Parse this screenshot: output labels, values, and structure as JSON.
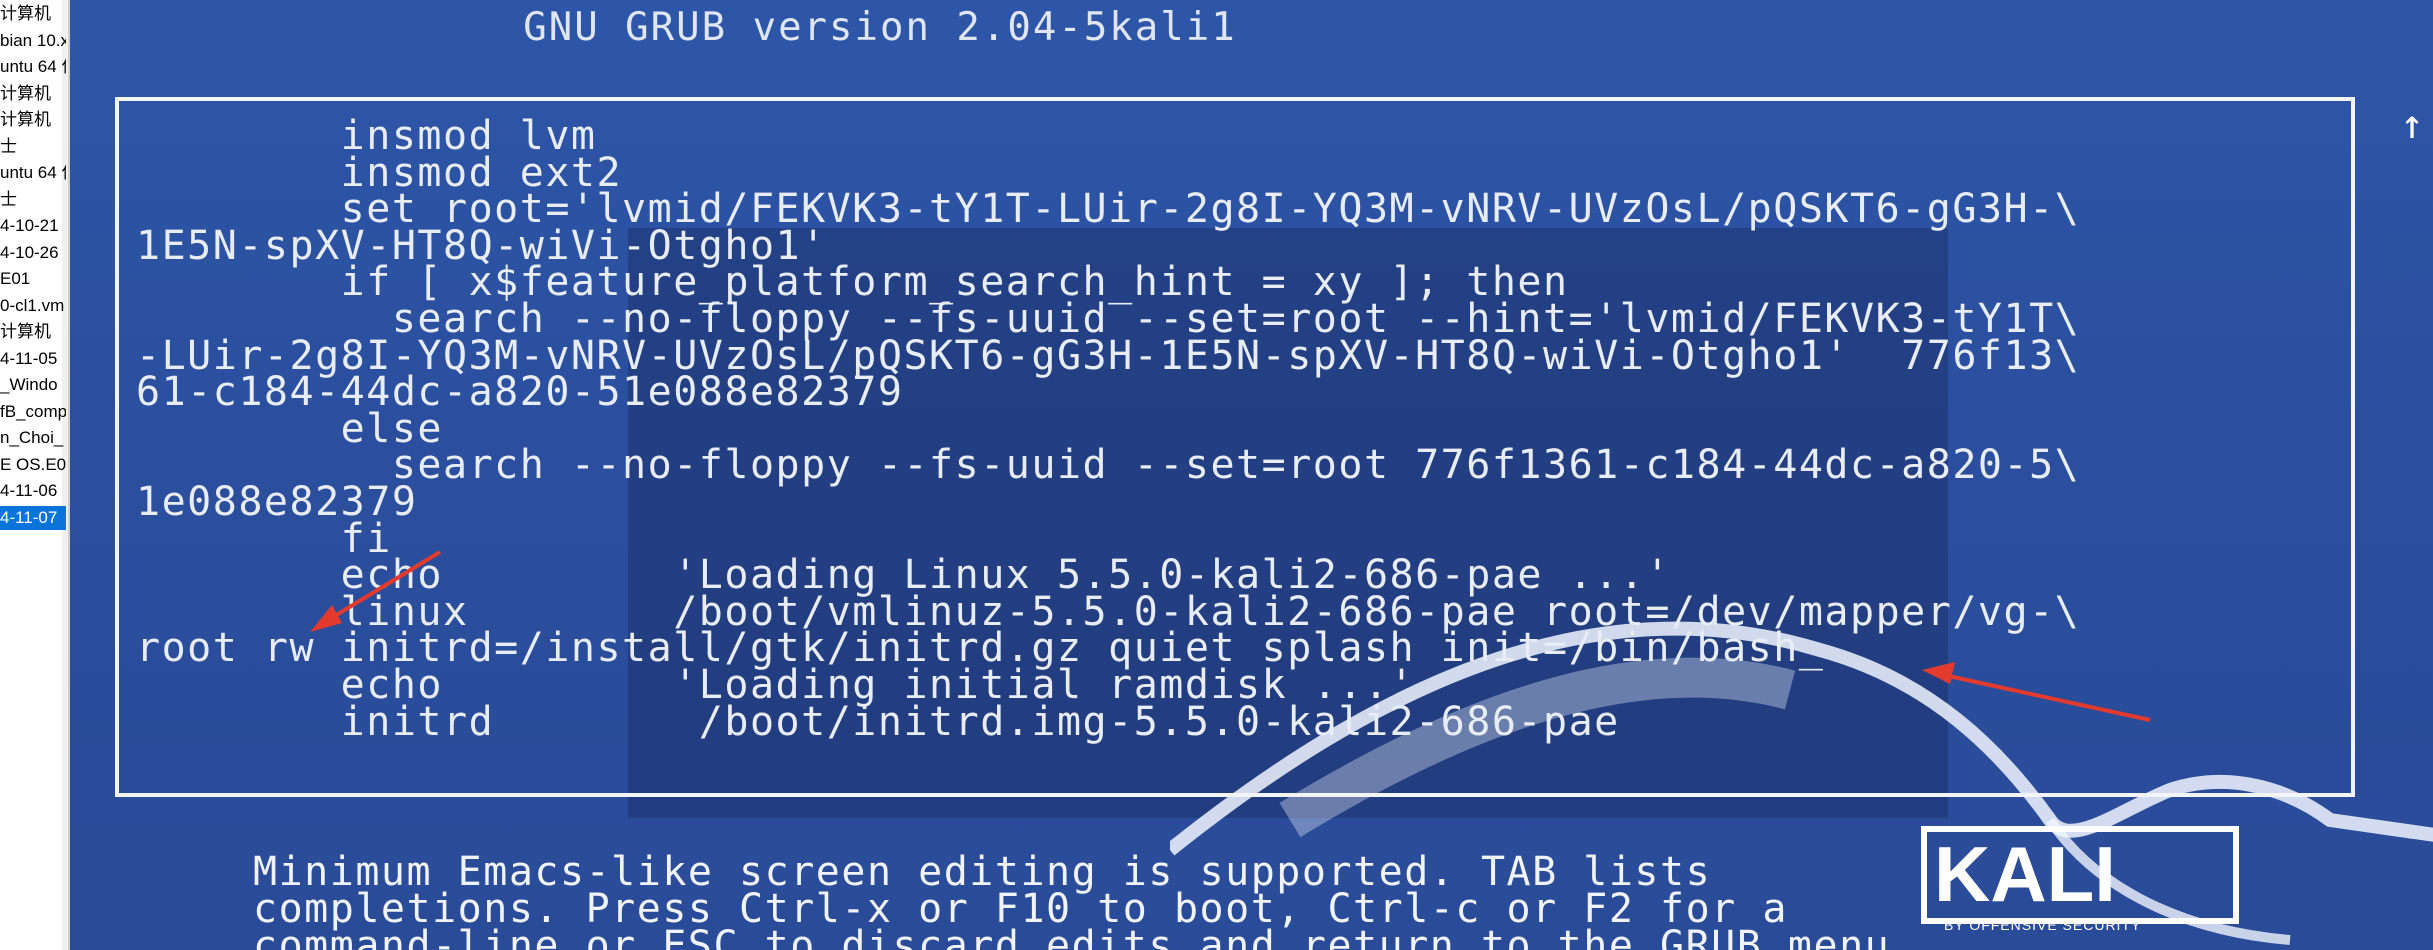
{
  "left_panel": {
    "items": [
      {
        "label": "计算机",
        "selected": false
      },
      {
        "label": "bian 10.x",
        "selected": false
      },
      {
        "label": "untu 64 位",
        "selected": false
      },
      {
        "label": "计算机",
        "selected": false
      },
      {
        "label": "计算机",
        "selected": false
      },
      {
        "label": "士",
        "selected": false
      },
      {
        "label": "untu 64 位",
        "selected": false
      },
      {
        "label": "士",
        "selected": false
      },
      {
        "label": "4-10-21",
        "selected": false
      },
      {
        "label": "4-10-26",
        "selected": false
      },
      {
        "label": "E01",
        "selected": false
      },
      {
        "label": "0-cl1.vm",
        "selected": false
      },
      {
        "label": "计算机",
        "selected": false
      },
      {
        "label": "4-11-05",
        "selected": false
      },
      {
        "label": "_Windo",
        "selected": false
      },
      {
        "label": "fB_comp",
        "selected": false
      },
      {
        "label": "n_Choi_",
        "selected": false
      },
      {
        "label": "E OS.E01",
        "selected": false
      },
      {
        "label": "4-11-06",
        "selected": false
      },
      {
        "label": "4-11-07",
        "selected": true
      }
    ]
  },
  "grub": {
    "title": "GNU GRUB  version 2.04-5kali1",
    "scroll_indicator": "↑",
    "code_lines": [
      "        insmod lvm",
      "        insmod ext2",
      "        set root='lvmid/FEKVK3-tY1T-LUir-2g8I-YQ3M-vNRV-UVzOsL/pQSKT6-gG3H-\\",
      "1E5N-spXV-HT8Q-wiVi-Otgho1'",
      "        if [ x$feature_platform_search_hint = xy ]; then",
      "          search --no-floppy --fs-uuid --set=root --hint='lvmid/FEKVK3-tY1T\\",
      "-LUir-2g8I-YQ3M-vNRV-UVzOsL/pQSKT6-gG3H-1E5N-spXV-HT8Q-wiVi-Otgho1'  776f13\\",
      "61-c184-44dc-a820-51e088e82379",
      "        else",
      "          search --no-floppy --fs-uuid --set=root 776f1361-c184-44dc-a820-5\\",
      "1e088e82379",
      "        fi",
      "        echo         'Loading Linux 5.5.0-kali2-686-pae ...'",
      "        linux        /boot/vmlinuz-5.5.0-kali2-686-pae root=/dev/mapper/vg-\\",
      "root rw initrd=/install/gtk/initrd.gz quiet splash init=/bin/bash_",
      "        echo         'Loading initial ramdisk ...'",
      "        initrd        /boot/initrd.img-5.5.0-kali2-686-pae"
    ],
    "help_lines": [
      "Minimum Emacs-like screen editing is supported. TAB lists",
      "completions. Press Ctrl-x or F10 to boot, Ctrl-c or F2 for a",
      "command-line or ESC to discard edits and return to the GRUB menu."
    ]
  },
  "kali_logo": {
    "word": "KALI",
    "tagline": "BY OFFENSIVE SECURITY"
  },
  "colors": {
    "grub_background": "#2b4f9e",
    "grub_text": "#e8ecf4",
    "annotation_arrow": "#e23b2e"
  }
}
